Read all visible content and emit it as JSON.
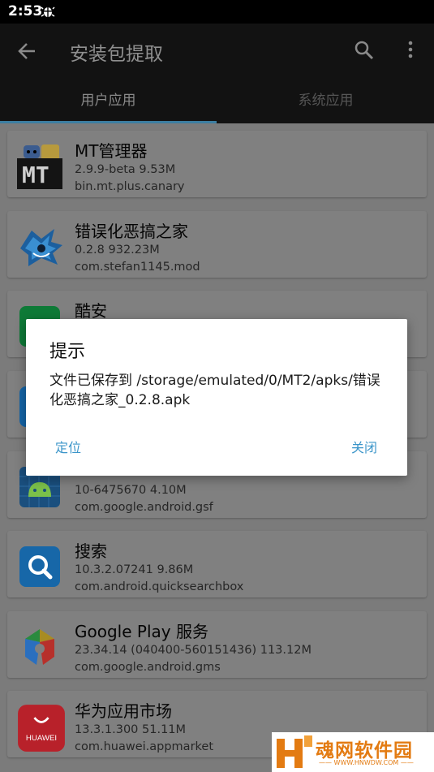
{
  "status_bar": {
    "time": "2:53",
    "bug_icon": "bug-icon"
  },
  "app_bar": {
    "title": "安装包提取"
  },
  "tabs": [
    {
      "label": "用户应用",
      "active": true
    },
    {
      "label": "系统应用",
      "active": false
    }
  ],
  "apps": [
    {
      "name": "MT管理器",
      "meta": "2.9.9-beta   9.53M",
      "package": "bin.mt.plus.canary",
      "icon": "mt-manager-icon"
    },
    {
      "name": "错误化恶搞之家",
      "meta": "0.2.8   932.23M",
      "package": "com.stefan1145.mod",
      "icon": "blue-creature-icon"
    },
    {
      "name": "酷安",
      "meta": "",
      "package": "",
      "icon": "coolapk-icon"
    },
    {
      "name": "",
      "meta": "",
      "package": "",
      "icon": "blue-app-icon"
    },
    {
      "name": "",
      "meta": "10-6475670   4.10M",
      "package": "com.google.android.gsf",
      "icon": "android-services-icon"
    },
    {
      "name": "搜索",
      "meta": "10.3.2.07241   9.86M",
      "package": "com.android.quicksearchbox",
      "icon": "search-app-icon"
    },
    {
      "name": "Google Play 服务",
      "meta": "23.34.14 (040400-560151436)   113.12M",
      "package": "com.google.android.gms",
      "icon": "google-play-services-icon"
    },
    {
      "name": "华为应用市场",
      "meta": "13.3.1.300   51.11M",
      "package": "com.huawei.appmarket",
      "icon": "huawei-appgallery-icon"
    }
  ],
  "huawei_logo_text": "HUAWEI",
  "dialog": {
    "title": "提示",
    "message": "文件已保存到 /storage/emulated/0/MT2/apks/错误化恶搞之家_0.2.8.apk",
    "locate_button": "定位",
    "close_button": "关闭"
  },
  "watermark": {
    "main": "魂网软件园",
    "sub": "—— WWW.HNWDW.COM ——"
  },
  "colors": {
    "accent": "#3b95c9",
    "tab_indicator": "#3c7ea1",
    "watermark": "#e37b12"
  }
}
